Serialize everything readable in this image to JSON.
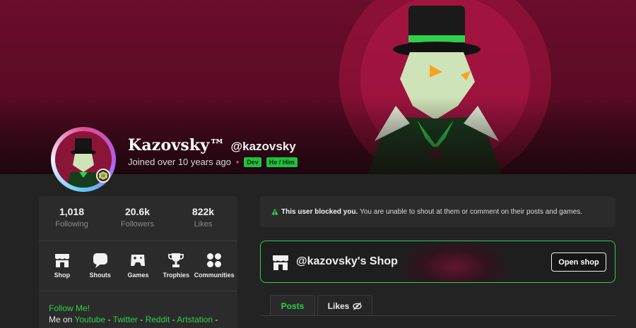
{
  "profile": {
    "display_name": "Kazovsky™",
    "username": "@kazovsky",
    "joined": "Joined over 10 years ago",
    "separator": "•",
    "tags": [
      "Dev",
      "He / Him"
    ]
  },
  "stats": [
    {
      "value": "1,018",
      "label": "Following"
    },
    {
      "value": "20.6k",
      "label": "Followers"
    },
    {
      "value": "822k",
      "label": "Likes"
    }
  ],
  "nav": [
    {
      "label": "Shop",
      "icon": "shop-icon"
    },
    {
      "label": "Shouts",
      "icon": "shouts-icon"
    },
    {
      "label": "Games",
      "icon": "games-icon"
    },
    {
      "label": "Trophies",
      "icon": "trophy-icon"
    },
    {
      "label": "Communities",
      "icon": "communities-icon"
    }
  ],
  "bio": {
    "title": "Follow Me!",
    "prefix": "Me on",
    "links": [
      "Youtube",
      "Twitter",
      "Reddit",
      "Artstation"
    ],
    "sep": "-"
  },
  "notice": {
    "strong": "This user blocked you.",
    "text": "You are unable to shout at them or comment on their posts and games."
  },
  "shop": {
    "title": "@kazovsky's Shop",
    "button": "Open shop"
  },
  "tabs": {
    "posts": "Posts",
    "likes": "Likes"
  },
  "colors": {
    "accent": "#2fd04a",
    "banner": "#6b0d2c",
    "background": "#232323",
    "card": "#2b2b2b"
  }
}
